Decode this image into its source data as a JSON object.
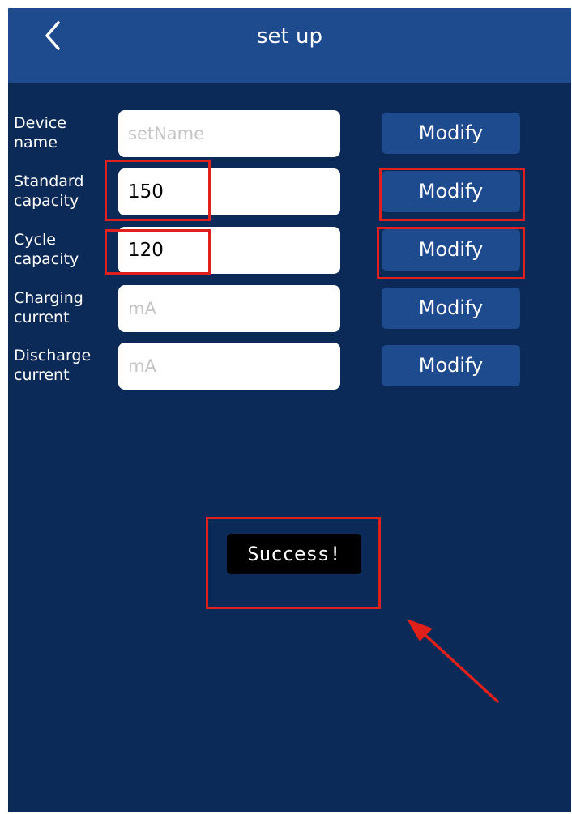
{
  "header": {
    "title": "set up",
    "back_icon": "chevron-left-icon"
  },
  "rows": [
    {
      "label_line1": "Device",
      "label_line2": "name",
      "input_value": "",
      "input_placeholder": "setName",
      "button_label": "Modify"
    },
    {
      "label_line1": "Standard",
      "label_line2": "capacity",
      "input_value": "150",
      "input_placeholder": "",
      "button_label": "Modify"
    },
    {
      "label_line1": "Cycle",
      "label_line2": "capacity",
      "input_value": "120",
      "input_placeholder": "",
      "button_label": "Modify"
    },
    {
      "label_line1": "Charging",
      "label_line2": "current",
      "input_value": "",
      "input_placeholder": "mA",
      "button_label": "Modify"
    },
    {
      "label_line1": "Discharge",
      "label_line2": "current",
      "input_value": "",
      "input_placeholder": "mA",
      "button_label": "Modify"
    }
  ],
  "toast": {
    "message": "Success!"
  },
  "colors": {
    "background": "#0c2a57",
    "header": "#1e4a8e",
    "button": "#1e4a8e",
    "annotation": "#e0201a",
    "toast": "#000000"
  }
}
